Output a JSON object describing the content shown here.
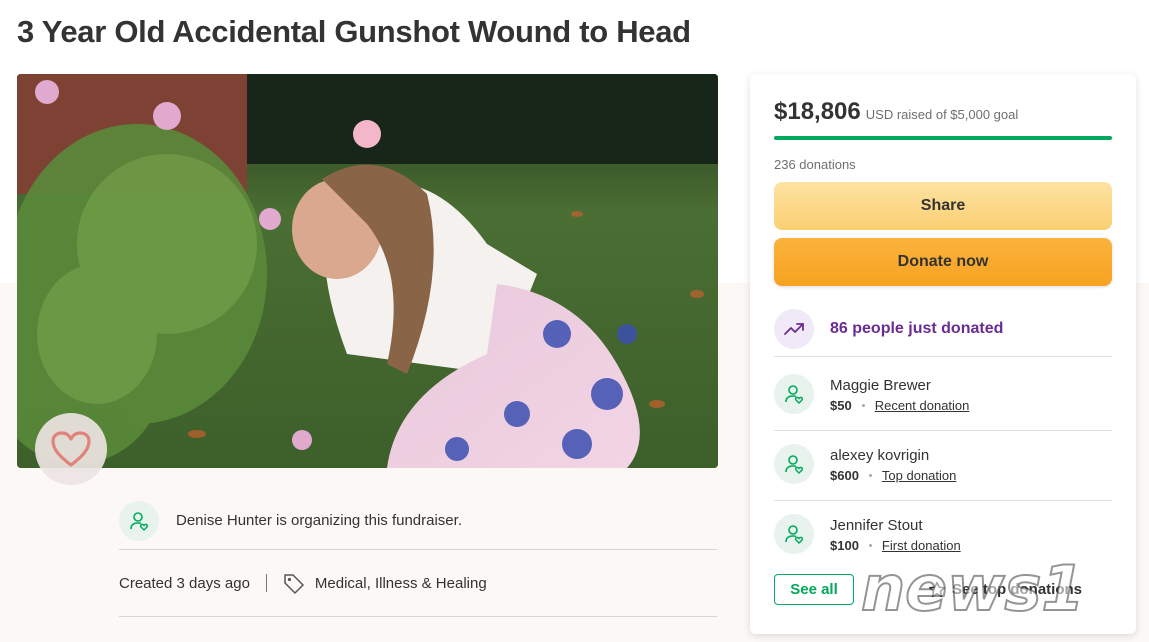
{
  "page": {
    "title": "3 Year Old Accidental Gunshot Wound to Head"
  },
  "hero": {
    "image": "girl-smelling-flowers-photo",
    "heart_icon": "heart-icon"
  },
  "organizer": {
    "text": "Denise Hunter is organizing this fundraiser."
  },
  "meta": {
    "created": "Created 3 days ago",
    "category": "Medical, Illness & Healing"
  },
  "donation_card": {
    "raised_amount": "$18,806",
    "goal_text": "USD raised of $5,000 goal",
    "progress_fraction": 1.0,
    "donation_count": "236 donations",
    "share_label": "Share",
    "donate_label": "Donate now",
    "trending_text": "86 people just donated",
    "donors": [
      {
        "name": "Maggie Brewer",
        "amount": "$50",
        "tag": "Recent donation"
      },
      {
        "name": "alexey kovrigin",
        "amount": "$600",
        "tag": "Top donation"
      },
      {
        "name": "Jennifer Stout",
        "amount": "$100",
        "tag": "First donation"
      }
    ],
    "see_all_label": "See all",
    "see_top_label": "See top donations"
  },
  "watermark": {
    "text": "news1"
  },
  "colors": {
    "accent_green": "#02a95c",
    "share_yellow": "#fbcf72",
    "donate_orange": "#f7a221",
    "trend_purple": "#6b2c91"
  }
}
